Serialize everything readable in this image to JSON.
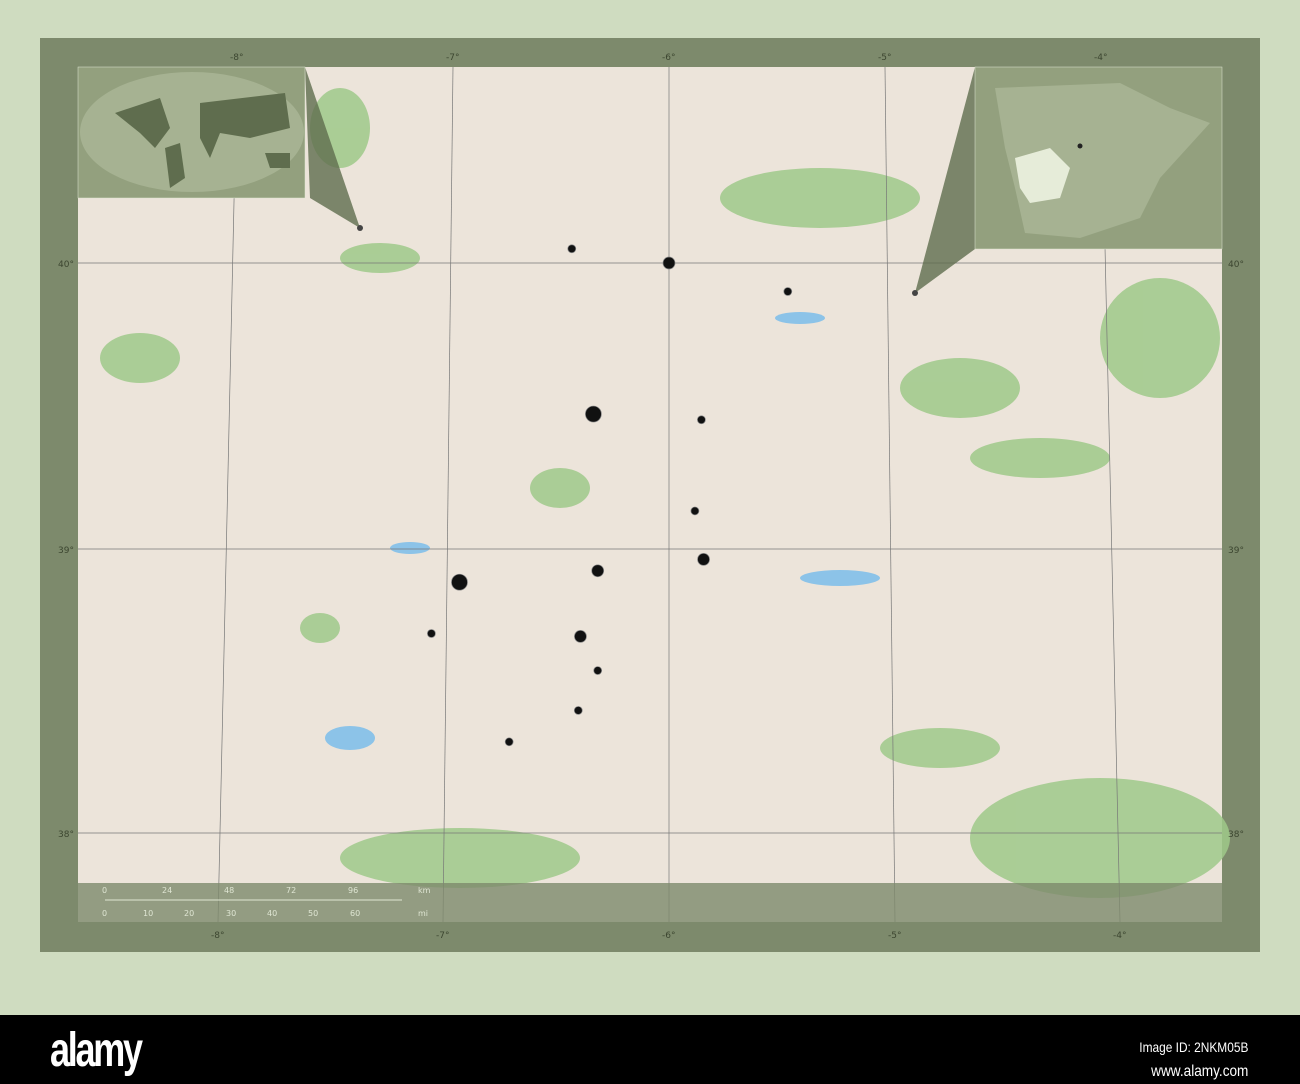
{
  "map": {
    "longitude_labels": [
      "-8°",
      "-7°",
      "-6°",
      "-5°",
      "-4°"
    ],
    "latitude_labels": [
      "40°",
      "39°",
      "38°"
    ],
    "scale_km": [
      "0",
      "24",
      "48",
      "72",
      "96"
    ],
    "scale_km_unit": "km",
    "scale_mi": [
      "0",
      "10",
      "20",
      "30",
      "40",
      "50",
      "60"
    ],
    "scale_mi_unit": "mi",
    "cities": [
      {
        "lon": -6.45,
        "lat": 40.05,
        "size": "small"
      },
      {
        "lon": -6.0,
        "lat": 40.0,
        "size": "medium"
      },
      {
        "lon": -5.45,
        "lat": 39.9,
        "size": "small"
      },
      {
        "lon": -6.35,
        "lat": 39.47,
        "size": "large"
      },
      {
        "lon": -5.85,
        "lat": 39.45,
        "size": "small"
      },
      {
        "lon": -5.88,
        "lat": 39.13,
        "size": "small"
      },
      {
        "lon": -6.33,
        "lat": 38.92,
        "size": "medium"
      },
      {
        "lon": -5.84,
        "lat": 38.96,
        "size": "medium"
      },
      {
        "lon": -6.97,
        "lat": 38.88,
        "size": "large"
      },
      {
        "lon": -7.1,
        "lat": 38.7,
        "size": "small"
      },
      {
        "lon": -6.41,
        "lat": 38.69,
        "size": "medium"
      },
      {
        "lon": -6.33,
        "lat": 38.57,
        "size": "small"
      },
      {
        "lon": -6.42,
        "lat": 38.43,
        "size": "small"
      },
      {
        "lon": -6.74,
        "lat": 38.32,
        "size": "small"
      }
    ],
    "colors": {
      "frame": "#7d8a6c",
      "land": "#ece4da",
      "forest": "#9fc98a",
      "water": "#8cc3e8",
      "inset": "#93a07e"
    }
  },
  "watermark": {
    "logo": "alamy",
    "image_id": "Image ID: 2NKM05B",
    "url": "www.alamy.com"
  }
}
